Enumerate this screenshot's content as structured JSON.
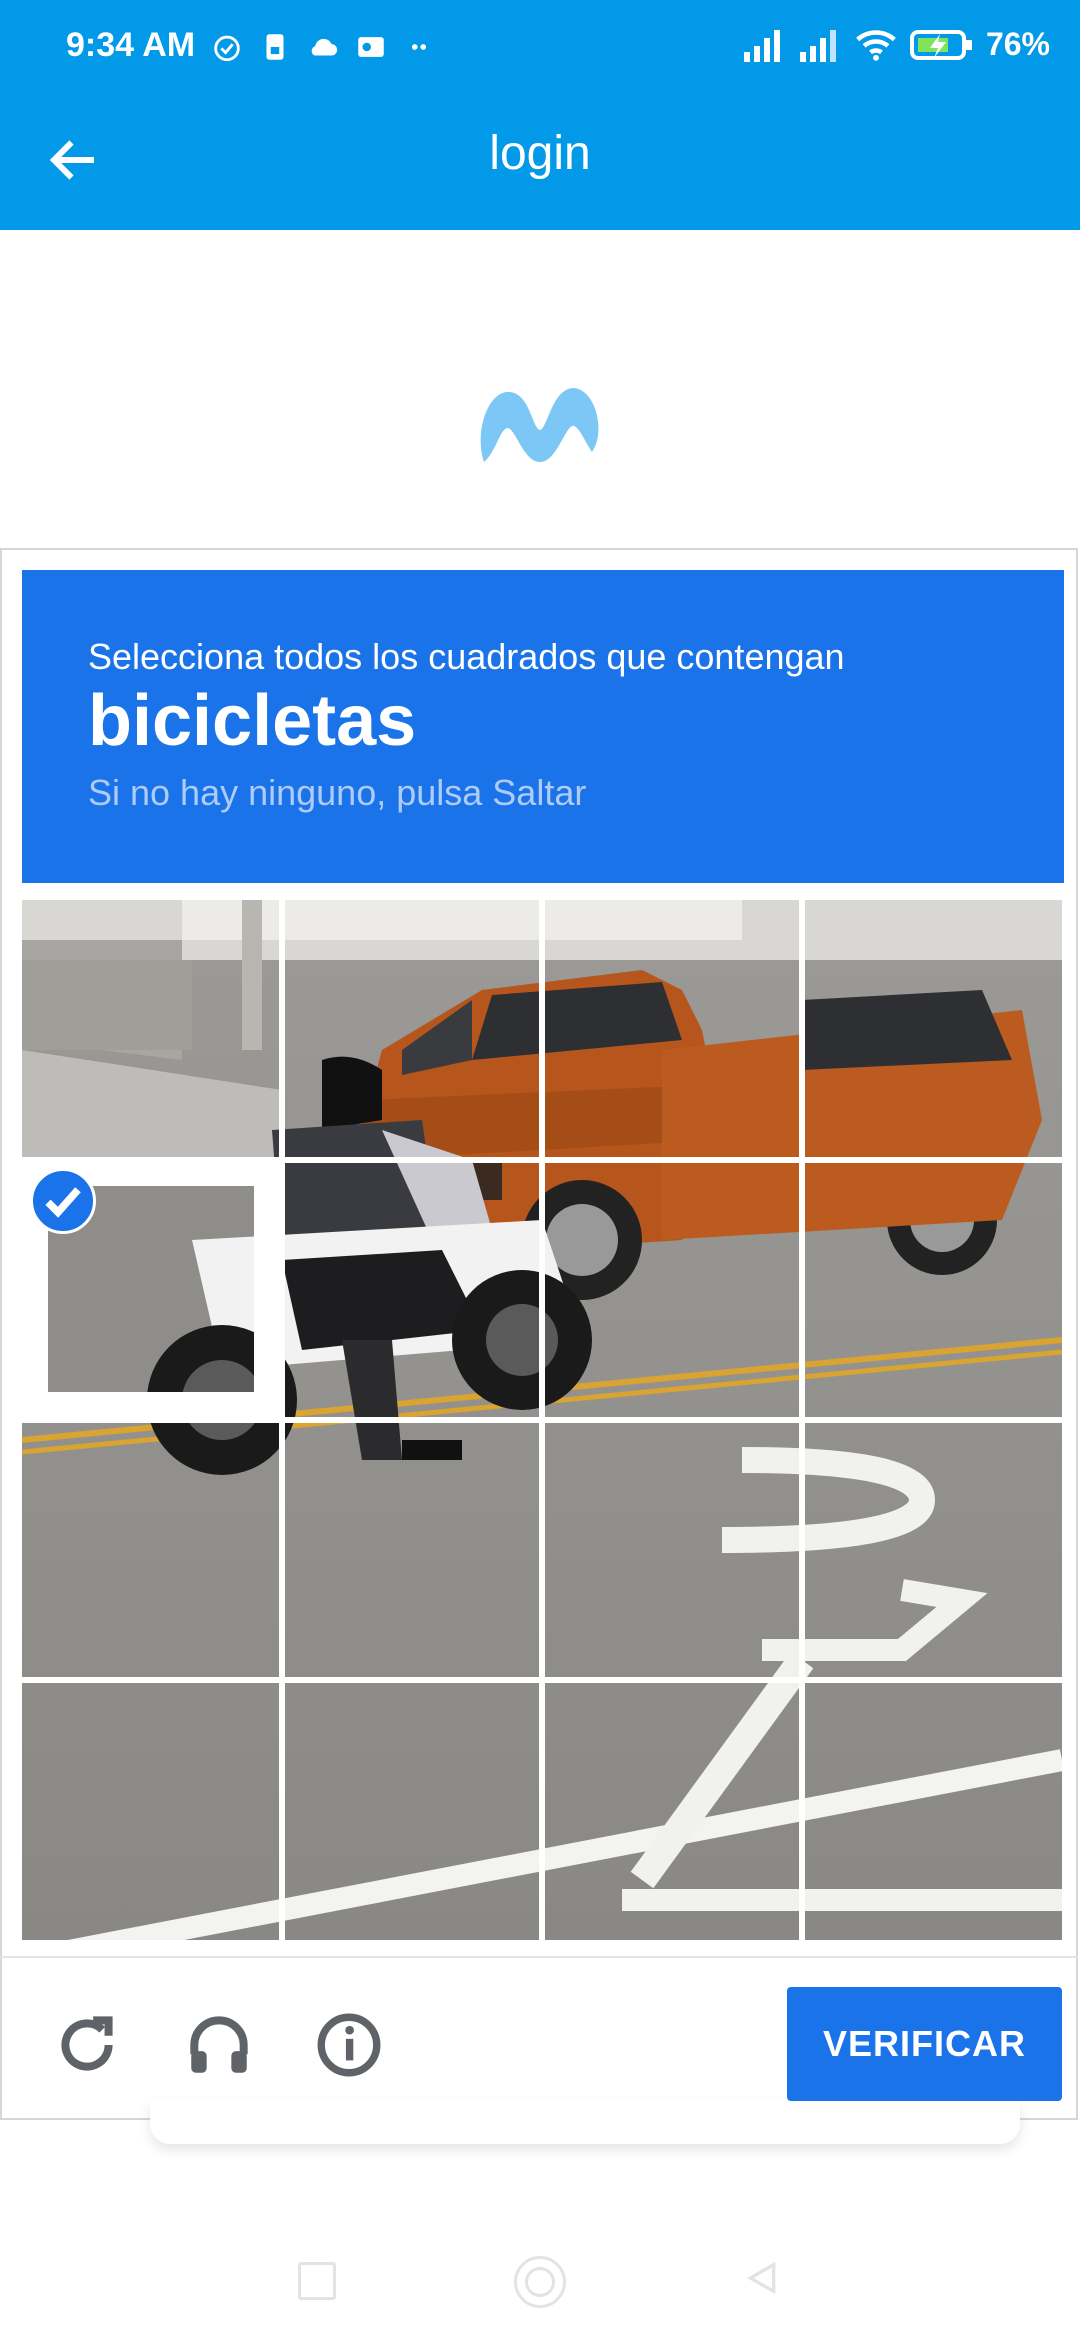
{
  "status_bar": {
    "time": "9:34 AM",
    "battery": "76",
    "battery_unit": "%"
  },
  "app_bar": {
    "title": "login"
  },
  "captcha": {
    "instruction": "Selecciona todos los cuadrados que contengan",
    "target": "bicicletas",
    "hint": "Si no hay ninguno, pulsa Saltar",
    "tiles_selected": [
      5
    ],
    "verify_label": "VERIFICAR"
  },
  "colors": {
    "app_bar": "#029ae8",
    "captcha_blue": "#1a73e8",
    "logo": "#7cc7f6"
  },
  "icons": [
    "back-arrow-icon",
    "alarm-icon",
    "sim-icon",
    "cloud-icon",
    "outlook-icon",
    "signal-icon",
    "wifi-icon",
    "battery-icon",
    "reload-icon",
    "headphones-icon",
    "info-icon",
    "check-icon"
  ]
}
